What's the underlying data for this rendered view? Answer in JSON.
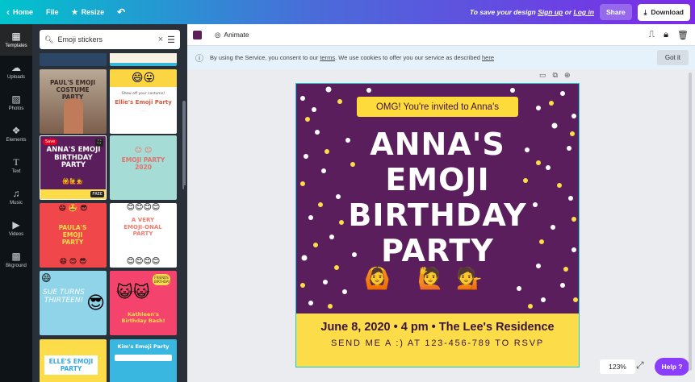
{
  "topbar": {
    "home": "Home",
    "file": "File",
    "resize": "Resize",
    "save_hint_prefix": "To save your design",
    "signup": "Sign up",
    "or": "or",
    "login": "Log in",
    "share": "Share",
    "download": "Download"
  },
  "sidenav": {
    "items": [
      {
        "label": "Templates",
        "icon": "templates-icon"
      },
      {
        "label": "Uploads",
        "icon": "upload-icon"
      },
      {
        "label": "Photos",
        "icon": "photos-icon"
      },
      {
        "label": "Elements",
        "icon": "elements-icon"
      },
      {
        "label": "Text",
        "icon": "text-icon"
      },
      {
        "label": "Music",
        "icon": "music-icon"
      },
      {
        "label": "Videos",
        "icon": "videos-icon"
      },
      {
        "label": "Bkground",
        "icon": "background-icon"
      }
    ]
  },
  "search": {
    "value": "Emoji  stickers"
  },
  "templates": {
    "t1": {
      "title": "PAUL'S EMOJI COSTUME PARTY"
    },
    "t2": {
      "title": "Ellie's Emoji Party",
      "sub": "Show off your costume!"
    },
    "t3": {
      "title": "ANNA'S EMOJI BIRTHDAY PARTY",
      "save": "Save",
      "free": "FREE"
    },
    "t4": {
      "title": "EMOJI PARTY 2020"
    },
    "t5": {
      "title": "PAULA'S EMOJI PARTY"
    },
    "t6": {
      "title": "A VERY EMOJI-ONAL PARTY"
    },
    "t7": {
      "title": "SUE TURNS THIRTEEN!"
    },
    "t8": {
      "title": "Kathleen's Birthday Bash!",
      "badge": "FRIENDS BIRTHDAY"
    },
    "t9": {
      "title": "ELLE'S EMOJI PARTY"
    },
    "t10": {
      "title": "Kim's Emoji Party"
    }
  },
  "editor": {
    "animate": "Animate",
    "swatch_color": "#5b1f59"
  },
  "cookie": {
    "text_before": "By using the Service, you consent to our",
    "terms": "terms",
    "text_mid": ". We use cookies to offer you our service as described",
    "here": "here",
    "button": "Got it"
  },
  "design": {
    "pill": "OMG! You're invited to Anna's",
    "line1": "ANNA'S",
    "line2": "EMOJI",
    "line3": "BIRTHDAY",
    "line4": "PARTY",
    "footer_line1": "June 8, 2020 • 4 pm • The Lee's Residence",
    "footer_line2": "SEND ME A :) AT 123-456-789 TO RSVP"
  },
  "zoom": "123%",
  "help": "Help ?"
}
